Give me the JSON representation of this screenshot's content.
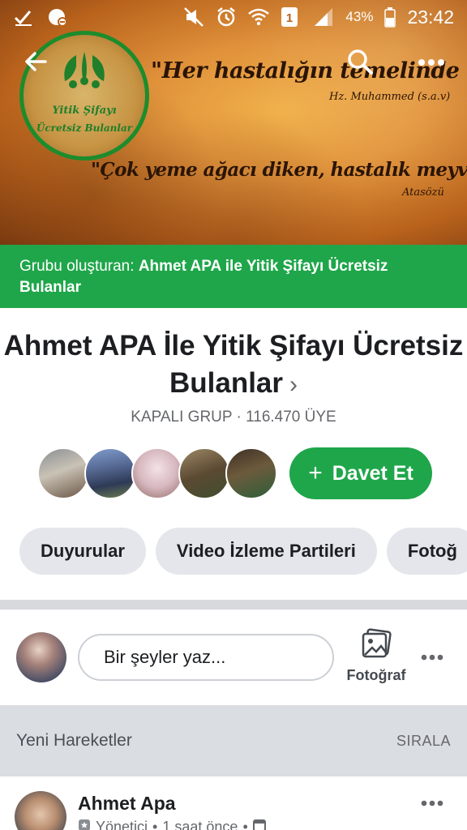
{
  "status_bar": {
    "battery_percent": "43%",
    "sim_slot": "1",
    "time": "23:42"
  },
  "cover": {
    "quote1": "\"Her hastalığın temelinde tokluk vardır\"",
    "author1": "Hz. Muhammed (s.a.v)",
    "quote2": "\"Çok yeme ağacı diken, hastalık meyvesi toplar\"",
    "author2": "Atasözü",
    "logo_text_line1": "Yitik Şifayı",
    "logo_text_line2": "Ücretsiz Bulanlar"
  },
  "creator": {
    "prefix": "Grubu oluşturan: ",
    "name": "Ahmet APA ile Yitik Şifayı Ücretsiz Bulanlar"
  },
  "group": {
    "title": "Ahmet APA İle Yitik Şifayı Ücretsiz Bulanlar",
    "meta": "KAPALI GRUP · 116.470 ÜYE"
  },
  "invite": {
    "plus": "+",
    "label": "Davet Et"
  },
  "tabs": [
    {
      "label": "Duyurular"
    },
    {
      "label": "Video İzleme Partileri"
    },
    {
      "label": "Fotoğ"
    }
  ],
  "composer": {
    "placeholder": "Bir şeyler yaz...",
    "photo_label": "Fotoğraf"
  },
  "section": {
    "title": "Yeni Hareketler",
    "sort": "SIRALA"
  },
  "post": {
    "author": "Ahmet Apa",
    "role": "Yönetici",
    "time": "1 saat önce"
  },
  "colors": {
    "accent": "#1fa64a",
    "pill_bg": "#e4e6eb",
    "section_bg": "#dadde1"
  },
  "icons": [
    "check-icon",
    "blocked-icon",
    "mute-icon",
    "alarm-icon",
    "wifi-icon",
    "sim-icon",
    "signal-icon",
    "battery-icon",
    "back-arrow-icon",
    "search-icon",
    "more-icon",
    "chevron-right-icon",
    "photo-icon",
    "shield-icon",
    "calendar-icon"
  ]
}
